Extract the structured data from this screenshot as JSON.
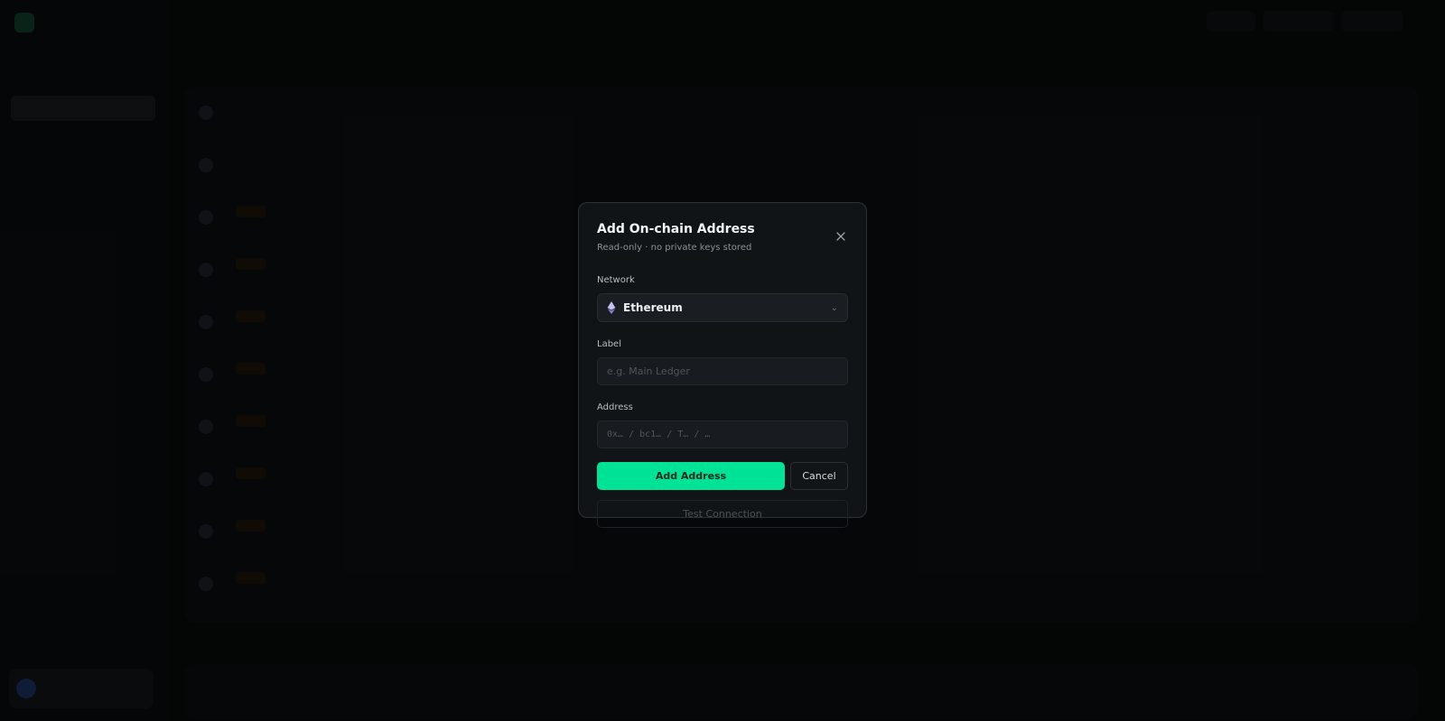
{
  "colors": {
    "accent": "#00e396",
    "modal_bg": "#111417",
    "backdrop": "#050607"
  },
  "modal": {
    "title": "Add On-chain Address",
    "subtitle": "Read-only · no private keys stored",
    "close_icon": "close-icon",
    "network": {
      "label": "Network",
      "value": "Ethereum",
      "icon": "ethereum-icon"
    },
    "label_field": {
      "label": "Label",
      "placeholder": "e.g. Main Ledger",
      "value": ""
    },
    "address_field": {
      "label": "Address",
      "placeholder": "0x… / bc1… / T… / …",
      "value": ""
    },
    "primary_button": "Add Address",
    "cancel_button": "Cancel",
    "test_button": "Test Connection"
  }
}
